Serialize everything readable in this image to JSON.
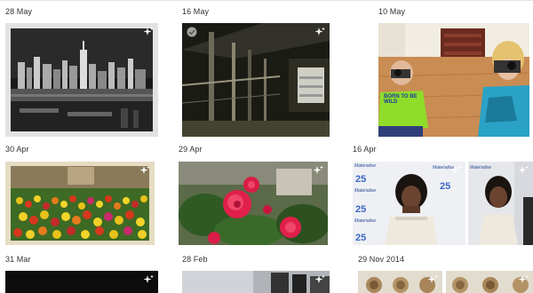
{
  "dates": {
    "d1": "28 May",
    "d2": "16 May",
    "d3": "10 May",
    "d4": "30 Apr",
    "d5": "29 Apr",
    "d6": "16 Apr",
    "d7": "31 Mar",
    "d8": "28 Feb",
    "d9": "29 Nov 2014"
  },
  "icons": {
    "enhance": "auto-enhance-sparkle-icon",
    "select": "select-check-icon"
  },
  "photo_texts": {
    "banner_word": "Materialise",
    "banner_num": "25",
    "shirt_text": "BORN TO BE WILD"
  },
  "colors": {
    "page_bg": "#ffffff",
    "date_text": "#333333",
    "sparkle": "#ffffff"
  }
}
